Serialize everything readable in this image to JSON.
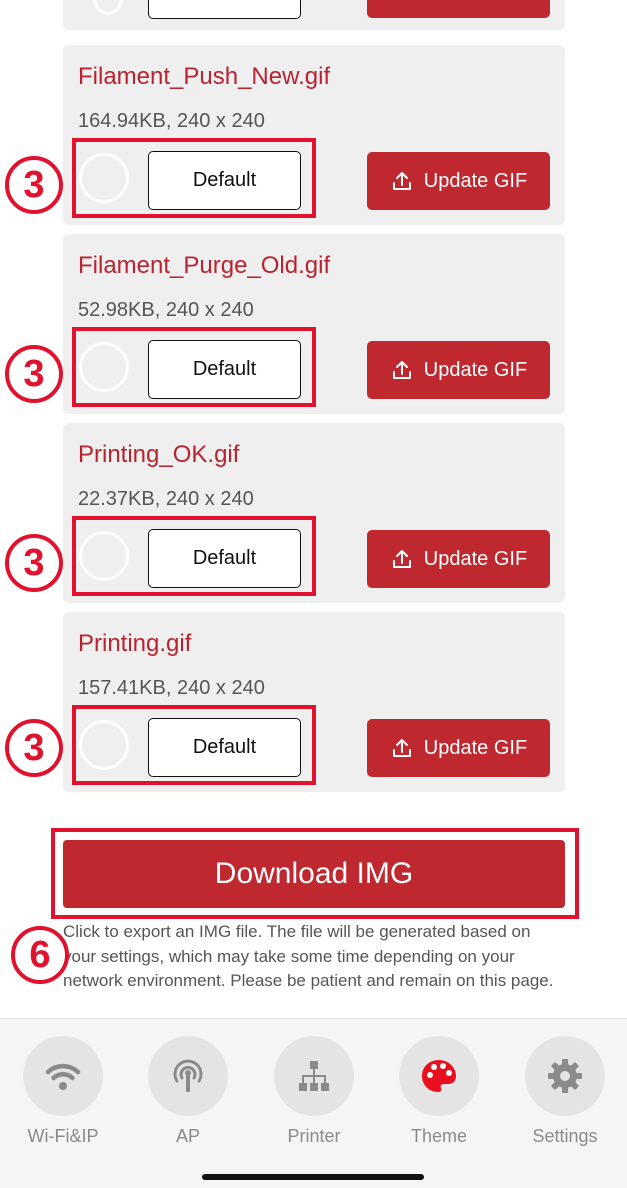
{
  "files": [
    {
      "name": "Filament_Push_New.gif",
      "meta": "164.94KB, 240 x 240",
      "default_label": "Default",
      "update_label": "Update GIF",
      "marker": "3"
    },
    {
      "name": "Filament_Purge_Old.gif",
      "meta": "52.98KB, 240 x 240",
      "default_label": "Default",
      "update_label": "Update GIF",
      "marker": "3"
    },
    {
      "name": "Printing_OK.gif",
      "meta": "22.37KB, 240 x 240",
      "default_label": "Default",
      "update_label": "Update GIF",
      "marker": "3"
    },
    {
      "name": "Printing.gif",
      "meta": "157.41KB, 240 x 240",
      "default_label": "Default",
      "update_label": "Update GIF",
      "marker": "3"
    }
  ],
  "download": {
    "label": "Download IMG",
    "note": "Click to export an IMG file. The file will be generated based on your settings, which may take some time depending on your network environment. Please be patient and remain on this page.",
    "marker": "6"
  },
  "nav": [
    {
      "label": "Wi-Fi&IP",
      "icon": "wifi-icon",
      "active": false
    },
    {
      "label": "AP",
      "icon": "antenna-icon",
      "active": false
    },
    {
      "label": "Printer",
      "icon": "network-tree-icon",
      "active": false
    },
    {
      "label": "Theme",
      "icon": "palette-icon",
      "active": true
    },
    {
      "label": "Settings",
      "icon": "gear-icon",
      "active": false
    }
  ],
  "colors": {
    "accent": "#c0282f",
    "title_red": "#b8232f",
    "annotation_red": "#e0122d",
    "card_bg": "#efefef",
    "nav_icon_gray": "#8a8a8a",
    "active_icon": "#e8101e"
  }
}
